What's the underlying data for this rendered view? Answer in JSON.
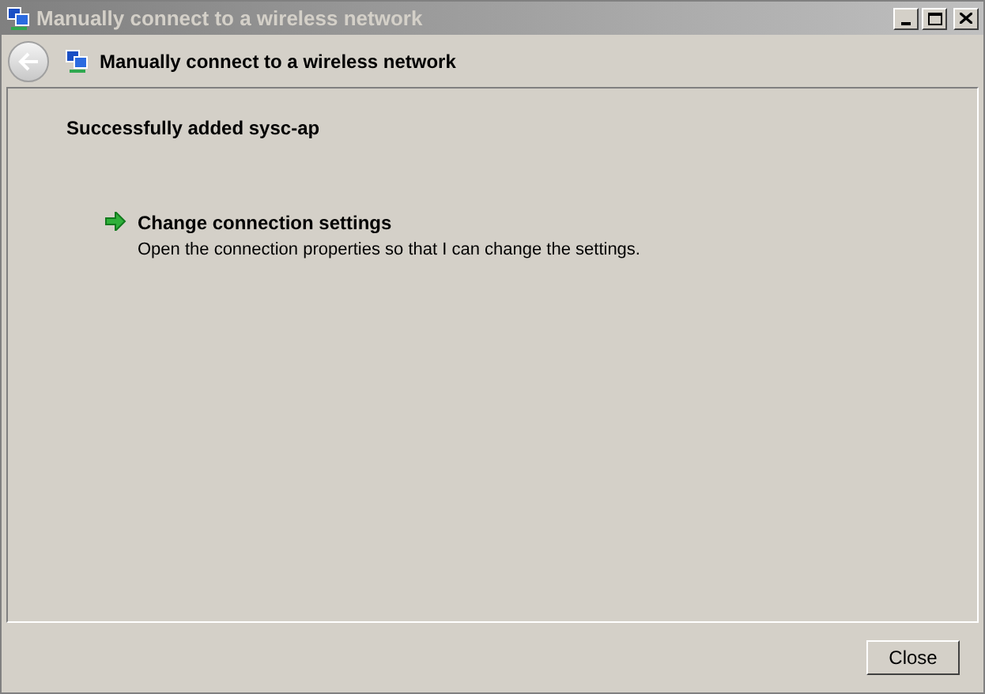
{
  "window": {
    "title": "Manually connect to a wireless network"
  },
  "header": {
    "title": "Manually connect to a wireless network"
  },
  "message": "Successfully added sysc-ap",
  "options": [
    {
      "title": "Change connection settings",
      "description": "Open the connection properties so that I can change the settings."
    }
  ],
  "buttons": [
    "Close"
  ]
}
